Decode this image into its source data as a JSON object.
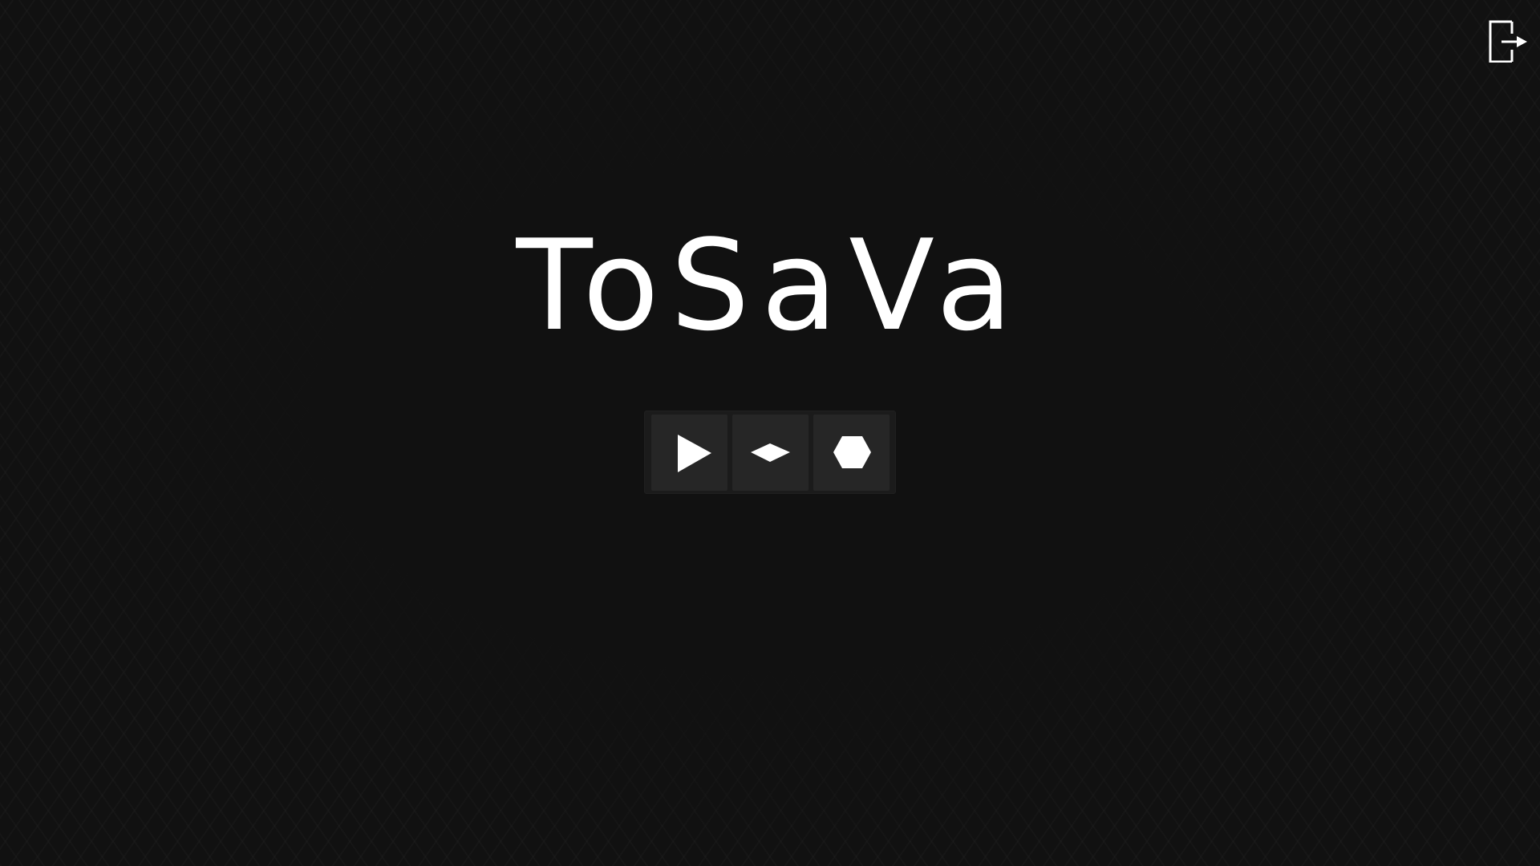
{
  "game": {
    "title": "ToSaVa"
  },
  "menu": {
    "buttons": [
      {
        "icon": "play-icon"
      },
      {
        "icon": "diamond-icon"
      },
      {
        "icon": "hexagon-icon"
      }
    ]
  },
  "top_right": {
    "icon": "exit-icon"
  },
  "colors": {
    "background": "#111111",
    "text": "#ffffff",
    "button": "#262626",
    "button_bar": "#1b1b1b"
  }
}
